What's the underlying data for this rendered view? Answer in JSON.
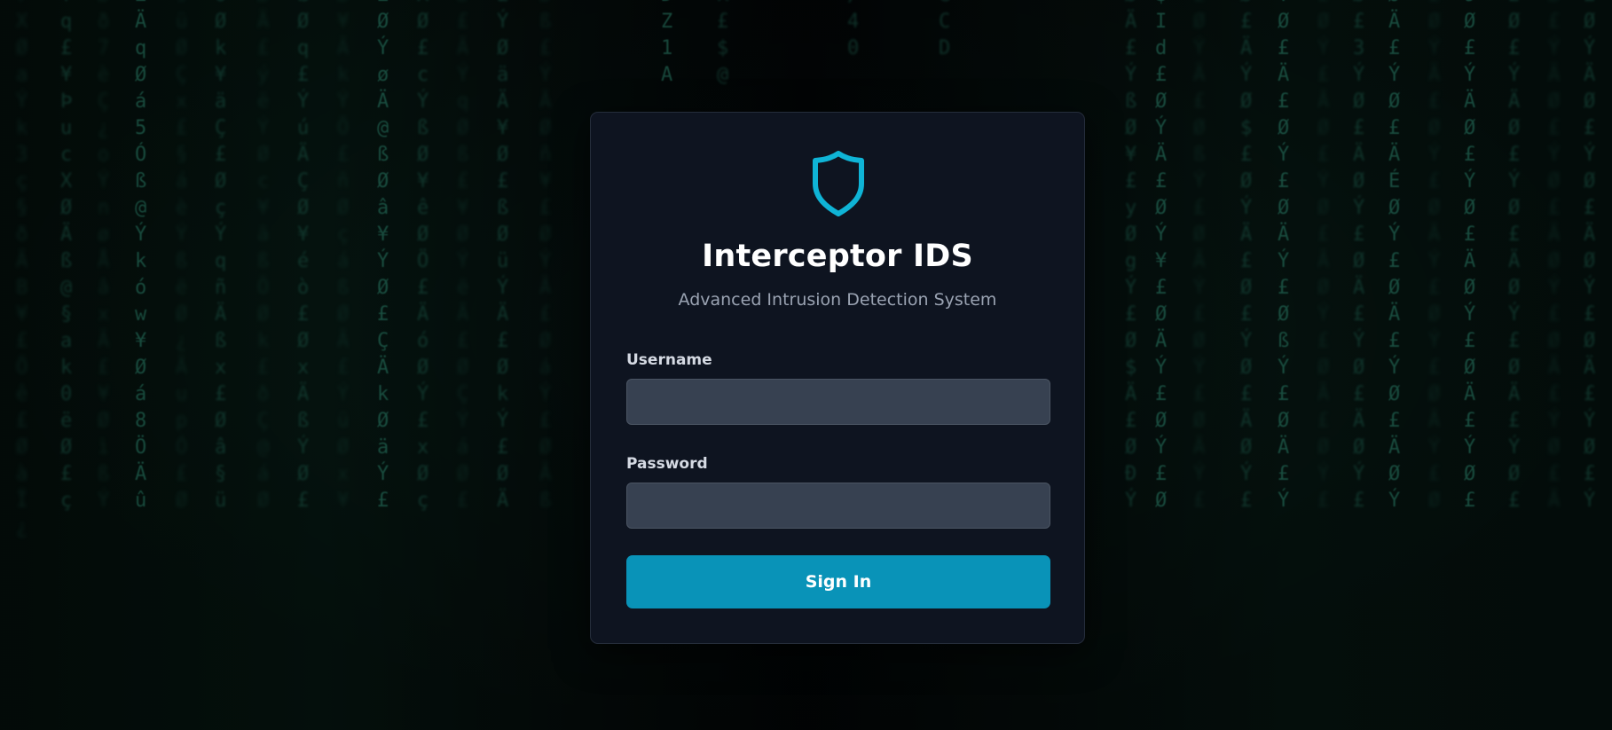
{
  "app": {
    "title": "Interceptor IDS",
    "subtitle": "Advanced Intrusion Detection System"
  },
  "form": {
    "username_label": "Username",
    "username_value": "",
    "password_label": "Password",
    "password_value": "",
    "submit_label": "Sign In"
  },
  "icons": {
    "logo": "shield-icon"
  },
  "colors": {
    "accent": "#0993b8",
    "logo_stroke": "#0fb4d6",
    "card_bg": "#0e1420",
    "input_bg": "#374151"
  }
}
